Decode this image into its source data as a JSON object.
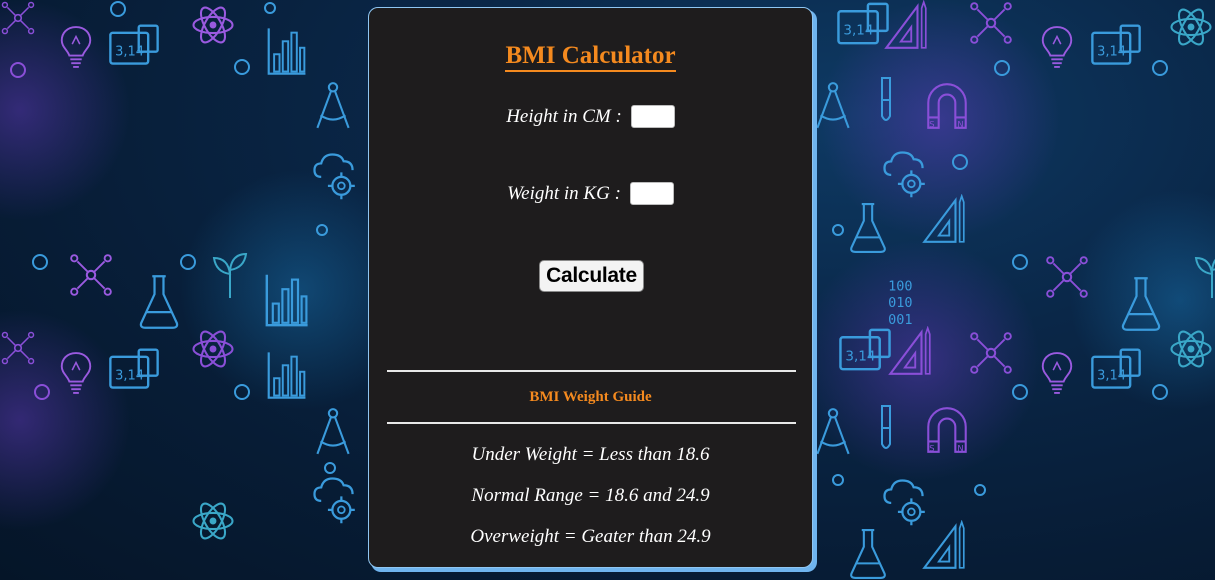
{
  "background": {
    "pattern_icons": [
      "atom-icon",
      "lightbulb-icon",
      "calculator-icon",
      "bar-chart-icon",
      "compass-icon",
      "test-tube-icon",
      "magnet-icon",
      "cloud-gear-icon",
      "flask-icon",
      "triangle-ruler-icon",
      "plant-icon",
      "binary-icon",
      "molecule-icon"
    ],
    "calculator_display": "3,14",
    "magnet_poles": [
      "S",
      "N"
    ],
    "binary_rows": [
      "100",
      "010",
      "001"
    ]
  },
  "app": {
    "title": "BMI Calculator",
    "height_label": "Height in CM :",
    "height_value": "",
    "weight_label": "Weight in KG :",
    "weight_value": "",
    "calculate_label": "Calculate"
  },
  "guide": {
    "title": "BMI Weight Guide",
    "lines": [
      "Under Weight = Less than 18.6",
      "Normal Range = 18.6 and 24.9",
      "Overweight = Geater than 24.9"
    ]
  },
  "colors": {
    "accent": "#f58a1f",
    "card_bg": "#1e1c1d",
    "card_border": "#8fc6f2",
    "page_bg": "#0a2748",
    "icon_blue": "#3a9bdc",
    "icon_purple": "#8a4fd8"
  }
}
